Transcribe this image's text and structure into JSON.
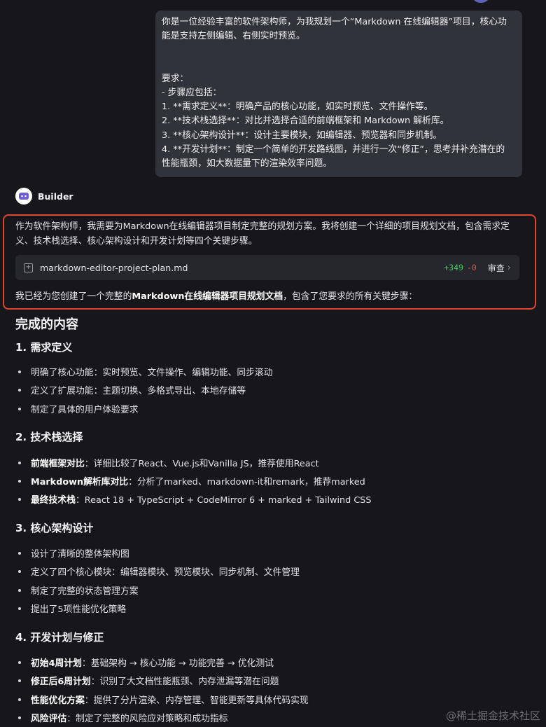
{
  "user_message": {
    "lines": [
      "你是一位经验丰富的软件架构师，为我规划一个“Markdown 在线编辑器”项目，核心功",
      "能是支持左侧编辑、右侧实时预览。",
      "",
      "",
      "要求：",
      "- 步骤应包括：",
      "  1.  **需求定义**：明确产品的核心功能，如实时预览、文件操作等。",
      "  2.  **技术栈选择**：对比并选择合适的前端框架和 Markdown 解析库。",
      "  3.  **核心架构设计**：设计主要模块，如编辑器、预览器和同步机制。",
      "  4.  **开发计划**：制定一个简单的开发路线图，并进行一次“修正”，思考并补充潜在的",
      "性能瓶颈，如大数据量下的渲染效率问题。"
    ]
  },
  "assistant": {
    "name": "Builder",
    "intro": "作为软件架构师，我需要为Markdown在线编辑器项目制定完整的规划方案。我将创建一个详细的项目规划文档，包含需求定义、技术栈选择、核心架构设计和开发计划等四个关键步骤。",
    "file": {
      "name": "markdown-editor-project-plan.md",
      "additions": "+349",
      "deletions": "-0",
      "review_label": "审查"
    },
    "summary_prefix": "我已经为您创建了一个完整的",
    "summary_bold": "Markdown在线编辑器项目规划文档",
    "summary_suffix": "，包含了您要求的所有关键步骤："
  },
  "content": {
    "heading": "完成的内容",
    "sections": [
      {
        "title": "1. 需求定义",
        "items": [
          {
            "bold": "",
            "text": "明确了核心功能：实时预览、文件操作、编辑功能、同步滚动"
          },
          {
            "bold": "",
            "text": "定义了扩展功能：主题切换、多格式导出、本地存储等"
          },
          {
            "bold": "",
            "text": "制定了具体的用户体验要求"
          }
        ]
      },
      {
        "title": "2. 技术栈选择",
        "items": [
          {
            "bold": "前端框架对比",
            "text": "：详细比较了React、Vue.js和Vanilla JS，推荐使用React"
          },
          {
            "bold": "Markdown解析库对比",
            "text": "：分析了marked、markdown-it和remark，推荐marked"
          },
          {
            "bold": "最终技术栈",
            "text": "：React 18 + TypeScript + CodeMirror 6 + marked + Tailwind CSS"
          }
        ]
      },
      {
        "title": "3. 核心架构设计",
        "items": [
          {
            "bold": "",
            "text": "设计了清晰的整体架构图"
          },
          {
            "bold": "",
            "text": "定义了四个核心模块：编辑器模块、预览模块、同步机制、文件管理"
          },
          {
            "bold": "",
            "text": "制定了完整的状态管理方案"
          },
          {
            "bold": "",
            "text": "提出了5项性能优化策略"
          }
        ]
      },
      {
        "title": "4. 开发计划与修正",
        "items": [
          {
            "bold": "初始4周计划",
            "text": "：基础架构 → 核心功能 → 功能完善 → 优化测试"
          },
          {
            "bold": "修正后6周计划",
            "text": "：识别了大文档性能瓶颈、内存泄漏等潜在问题"
          },
          {
            "bold": "性能优化方案",
            "text": "：提供了分片渲染、内存管理、智能更新等具体代码实现"
          },
          {
            "bold": "风险评估",
            "text": "：制定了完整的风险应对策略和成功指标"
          }
        ]
      }
    ]
  },
  "watermark": "@稀土掘金技术社区",
  "colors": {
    "background": "#17171b",
    "user_bubble": "#30333a",
    "highlight_border": "#e0452e",
    "diff_add": "#4ec36b",
    "diff_del": "#e5534b"
  }
}
